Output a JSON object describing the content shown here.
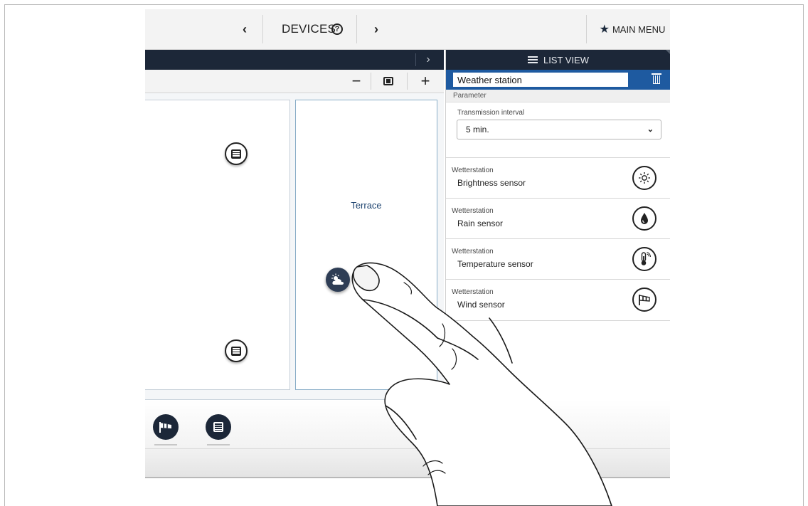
{
  "topbar": {
    "prev_glyph": "‹",
    "next_glyph": "›",
    "title": "DEVICES",
    "help_glyph": "?",
    "main_menu_label": "MAIN MENU",
    "main_menu_icon": "star-icon"
  },
  "canvas": {
    "zoom_out_glyph": "−",
    "zoom_in_glyph": "+",
    "collapse_glyph": "›",
    "rooms": [
      {
        "name": ""
      },
      {
        "name": "Terrace"
      }
    ]
  },
  "panel": {
    "header_label": "LIST VIEW",
    "device_name": "Weather station",
    "parameter_header": "Parameter",
    "transmission_interval_label": "Transmission interval",
    "transmission_interval_value": "5 min.",
    "sensors": [
      {
        "group": "Wetterstation",
        "name": "Brightness sensor",
        "icon": "sun-icon"
      },
      {
        "group": "Wetterstation",
        "name": "Rain sensor",
        "icon": "raindrop-icon"
      },
      {
        "group": "Wetterstation",
        "name": "Temperature sensor",
        "icon": "thermometer-icon"
      },
      {
        "group": "Wetterstation",
        "name": "Wind sensor",
        "icon": "windsock-icon"
      }
    ]
  },
  "colors": {
    "dark_navy": "#1c2738",
    "accent_blue": "#1e5aa0",
    "room_label": "#1e4470"
  }
}
